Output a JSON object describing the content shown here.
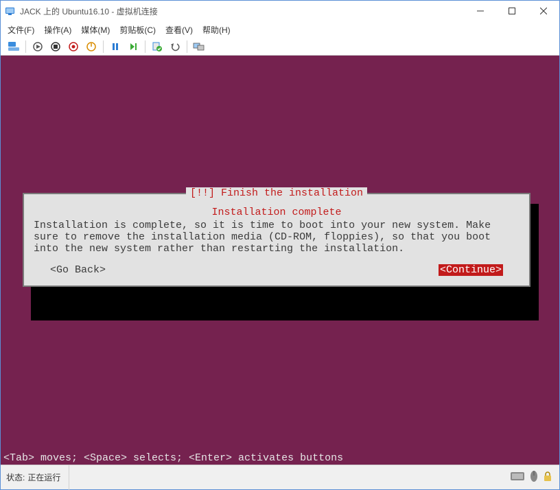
{
  "window": {
    "title": "JACK 上的 Ubuntu16.10 - 虚拟机连接"
  },
  "menubar": {
    "file": "文件(F)",
    "action": "操作(A)",
    "media": "媒体(M)",
    "clipboard": "剪贴板(C)",
    "view": "查看(V)",
    "help": "帮助(H)"
  },
  "installer": {
    "dialog_title": "[!!] Finish the installation",
    "sub_title": "Installation complete",
    "message": "Installation is complete, so it is time to boot into your new system. Make sure to remove the installation media (CD-ROM, floppies), so that you boot into the new system rather than restarting the installation.",
    "go_back": "<Go Back>",
    "continue": "<Continue>",
    "hints": "<Tab> moves; <Space> selects; <Enter> activates buttons"
  },
  "statusbar": {
    "label": "状态:",
    "value": "正在运行"
  }
}
